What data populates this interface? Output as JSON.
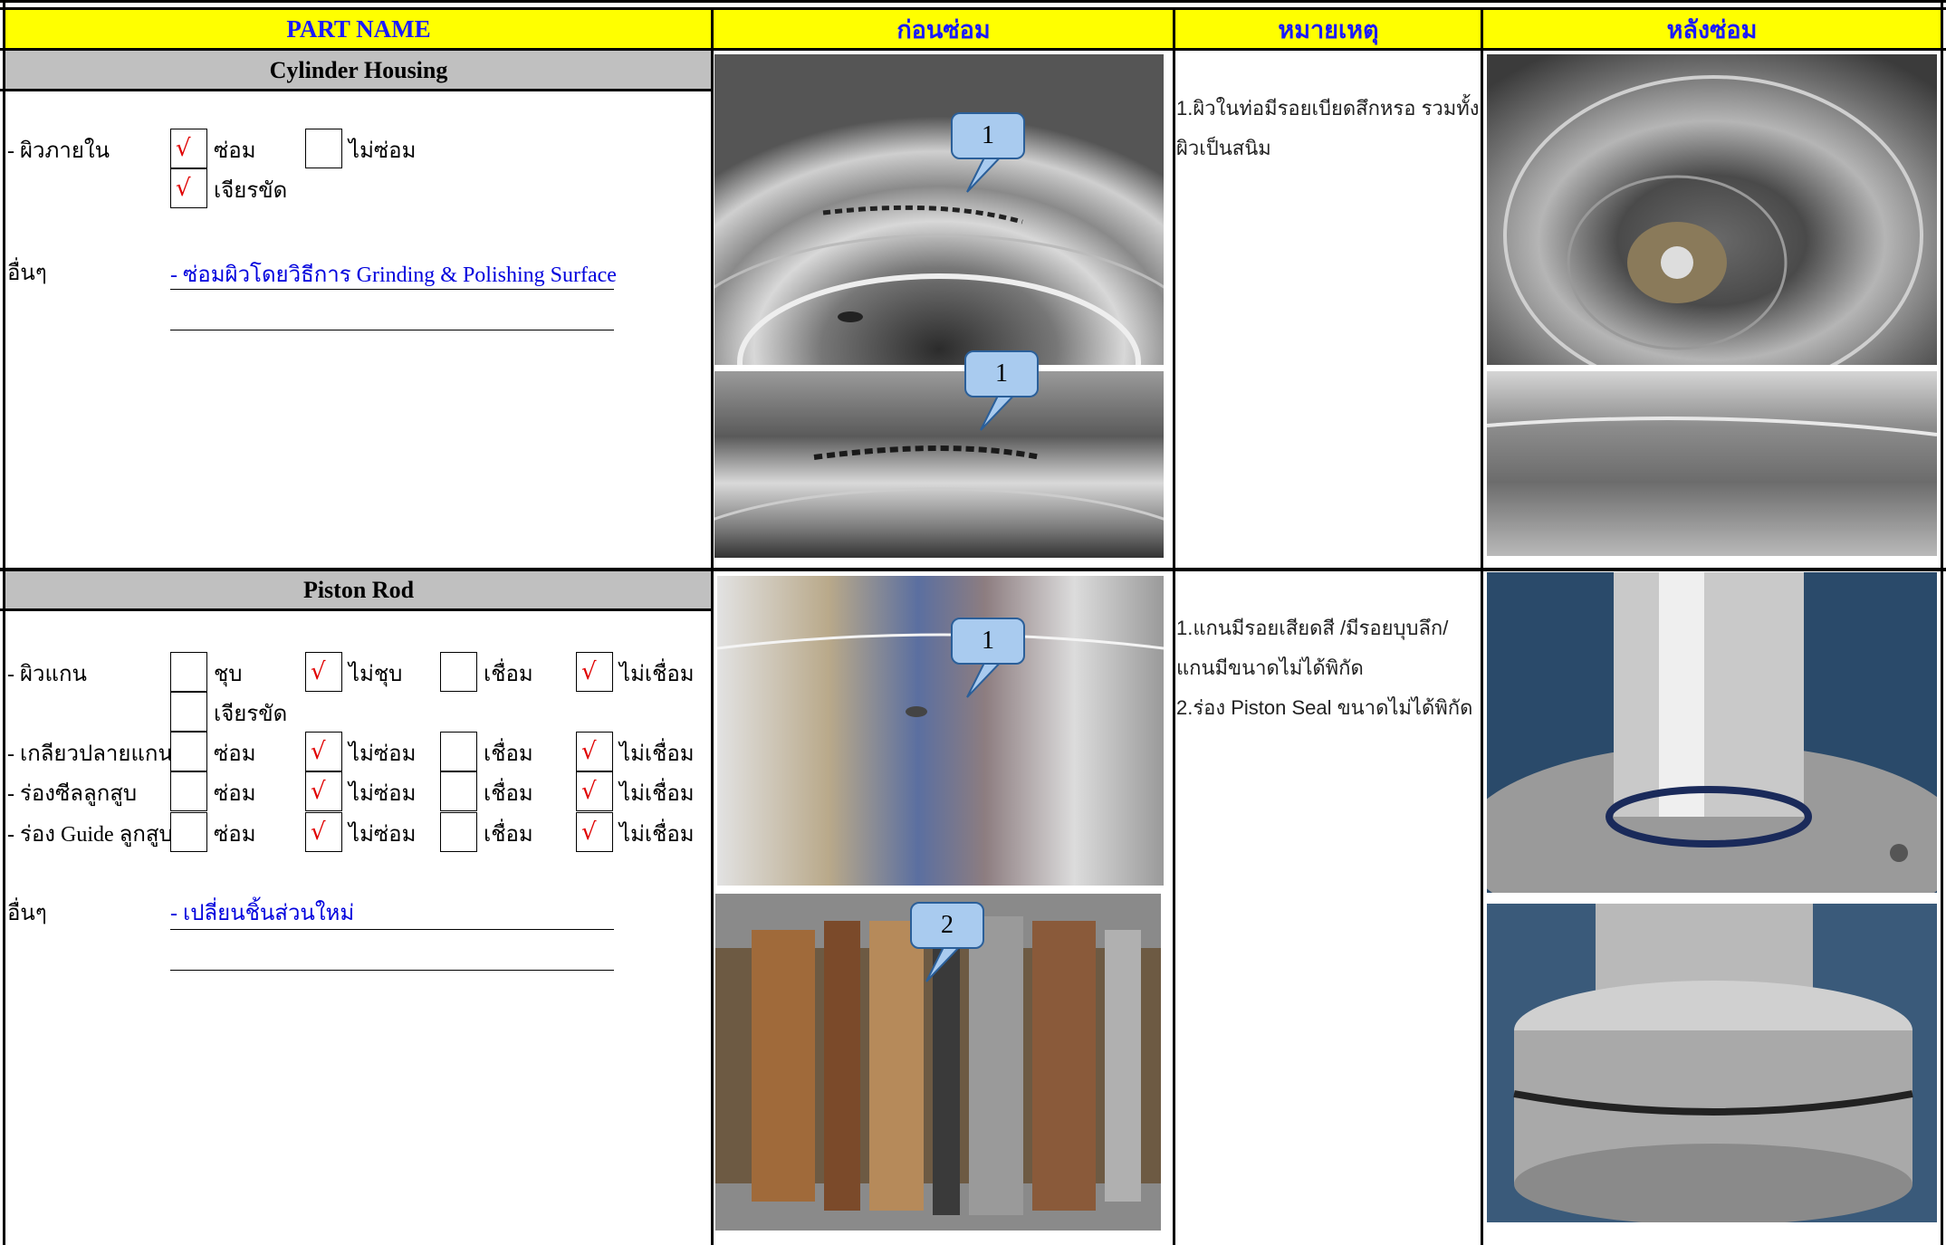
{
  "header": {
    "part_name": "PART NAME",
    "before": "ก่อนซ่อม",
    "remark": "หมายเหตุ",
    "after": "หลังซ่อม"
  },
  "cylinder": {
    "title": "Cylinder Housing",
    "row_label": "- ผิวภายใน",
    "opt_repair": "ซ่อม",
    "opt_norepair": "ไม่ซ่อม",
    "opt_polish": "เจียรขัด",
    "checked": {
      "repair": true,
      "norepair": false,
      "polish": true
    },
    "others_label": "อื่นๆ",
    "others_text": "- ซ่อมผิวโดยวิธีการ  Grinding & Polishing Surface",
    "remark_lines": [
      "1.ผิวในท่อมีรอยเบียดสึกหรอ รวมทั้ง",
      "ผิวเป็นสนิม"
    ],
    "callouts": [
      "1",
      "1"
    ],
    "photos": [
      "cylinder-before-photo-1",
      "cylinder-before-photo-2",
      "cylinder-after-photo-1",
      "cylinder-after-photo-2"
    ]
  },
  "piston": {
    "title": "Piston Rod",
    "rows": [
      {
        "label": "- ผิวแกน",
        "c1": "ชุบ",
        "c2": "ไม่ชุบ",
        "c3": "เชื่อม",
        "c4": "ไม่เชื่อม",
        "checks": [
          false,
          true,
          false,
          true
        ],
        "extra": "เจียรขัด"
      },
      {
        "label": "- เกลียวปลายแกน",
        "c1": "ซ่อม",
        "c2": "ไม่ซ่อม",
        "c3": "เชื่อม",
        "c4": "ไม่เชื่อม",
        "checks": [
          false,
          true,
          false,
          true
        ]
      },
      {
        "label": "- ร่องซีลลูกสูบ",
        "c1": "ซ่อม",
        "c2": "ไม่ซ่อม",
        "c3": "เชื่อม",
        "c4": "ไม่เชื่อม",
        "checks": [
          false,
          true,
          false,
          true
        ]
      },
      {
        "label": "- ร่อง Guide ลูกสูบ",
        "c1": "ซ่อม",
        "c2": "ไม่ซ่อม",
        "c3": "เชื่อม",
        "c4": "ไม่เชื่อม",
        "checks": [
          false,
          true,
          false,
          true
        ]
      }
    ],
    "others_label": "อื่นๆ",
    "others_text": "- เปลี่ยนชิ้นส่วนใหม่",
    "remark_lines": [
      "1.แกนมีรอยเสียดสี  /มีรอยบุบลึก/",
      "แกนมีขนาดไม่ได้พิกัด",
      "2.ร่อง Piston Seal ขนาดไม่ได้พิกัด"
    ],
    "callouts": [
      "1",
      "2"
    ],
    "photos": [
      "rod-before-photo-1",
      "rod-before-photo-2",
      "rod-after-photo-1",
      "rod-after-photo-2"
    ]
  },
  "check_mark": "√"
}
